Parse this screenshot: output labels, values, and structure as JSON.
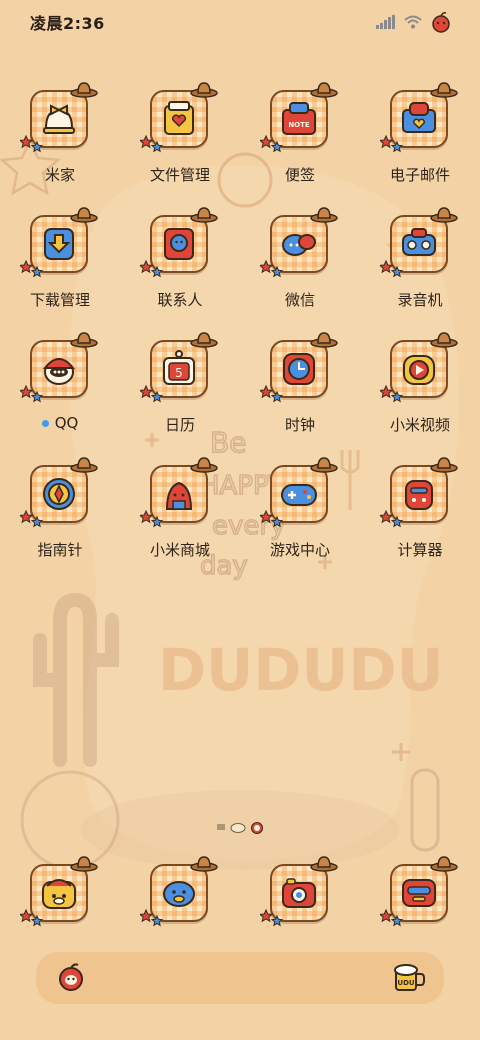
{
  "status_bar": {
    "time": "凌晨2:36",
    "icons": [
      "signal-icon",
      "wifi-icon",
      "apple-battery-icon"
    ]
  },
  "apps": [
    {
      "label": "米家",
      "icon": "bell-bow-icon"
    },
    {
      "label": "文件管理",
      "icon": "file-folder-icon"
    },
    {
      "label": "便签",
      "icon": "note-icon",
      "icon_text": "NOTE"
    },
    {
      "label": "电子邮件",
      "icon": "mail-box-icon"
    },
    {
      "label": "下载管理",
      "icon": "download-icon"
    },
    {
      "label": "联系人",
      "icon": "contacts-icon"
    },
    {
      "label": "微信",
      "icon": "wechat-icon"
    },
    {
      "label": "录音机",
      "icon": "recorder-icon"
    },
    {
      "label": "QQ",
      "icon": "qq-penguin-icon",
      "notification_dot": true
    },
    {
      "label": "日历",
      "icon": "calendar-icon",
      "icon_text": "5"
    },
    {
      "label": "时钟",
      "icon": "clock-icon"
    },
    {
      "label": "小米视频",
      "icon": "video-play-icon"
    },
    {
      "label": "指南针",
      "icon": "compass-icon"
    },
    {
      "label": "小米商城",
      "icon": "mi-store-icon"
    },
    {
      "label": "游戏中心",
      "icon": "gamepad-icon"
    },
    {
      "label": "计算器",
      "icon": "calculator-icon"
    }
  ],
  "dock": [
    {
      "icon": "phone-icon"
    },
    {
      "icon": "messages-icon"
    },
    {
      "icon": "camera-icon"
    },
    {
      "icon": "browser-icon"
    }
  ],
  "wallpaper_text": {
    "line1": "Be",
    "line2": "HAPPY",
    "line3": "every",
    "line4": "day",
    "brand": "DUDUDU"
  },
  "bottom_bar": {
    "left_icon": "apple-face-icon",
    "right_icon": "beer-mug-icon",
    "right_text": "UDU"
  },
  "colors": {
    "background": "#f3d3a6",
    "icon_border": "#7a4a22",
    "accent_red": "#e0453a",
    "accent_blue": "#4a8fe0",
    "accent_yellow": "#f5c542",
    "notification_dot": "#3a9df0"
  }
}
